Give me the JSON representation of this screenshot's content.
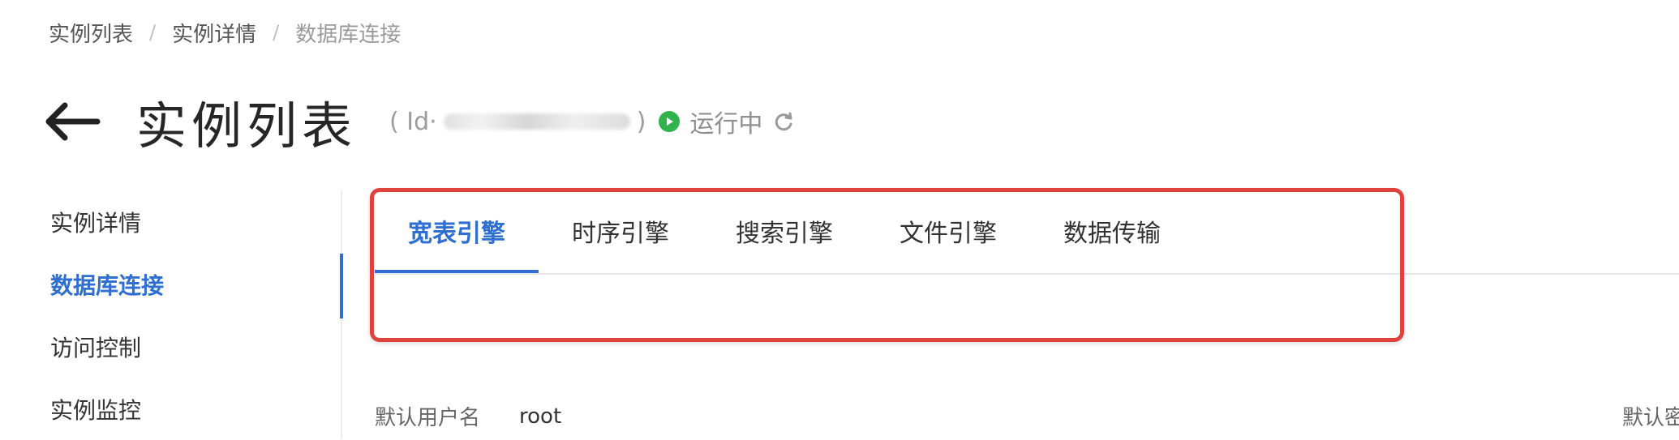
{
  "breadcrumb": [
    "实例列表",
    "实例详情",
    "数据库连接"
  ],
  "breadcrumb_separator": "/",
  "header": {
    "title": "实例列表",
    "id_open": "( Id·",
    "id_close": ")",
    "status": "运行中",
    "status_color": "#2fb34a"
  },
  "sidebar": {
    "items": [
      {
        "label": "实例详情"
      },
      {
        "label": "数据库连接",
        "active": true
      },
      {
        "label": "访问控制"
      },
      {
        "label": "实例监控"
      }
    ]
  },
  "tabs": [
    "宽表引擎",
    "时序引擎",
    "搜索引擎",
    "文件引擎",
    "数据传输"
  ],
  "active_tab": "宽表引擎",
  "content": {
    "default_user_label": "默认用户名",
    "default_user_value": "root",
    "default_password_label_partial": "默认密"
  },
  "colors": {
    "accent": "#2e6fd1",
    "highlight_border": "#e0433b"
  }
}
